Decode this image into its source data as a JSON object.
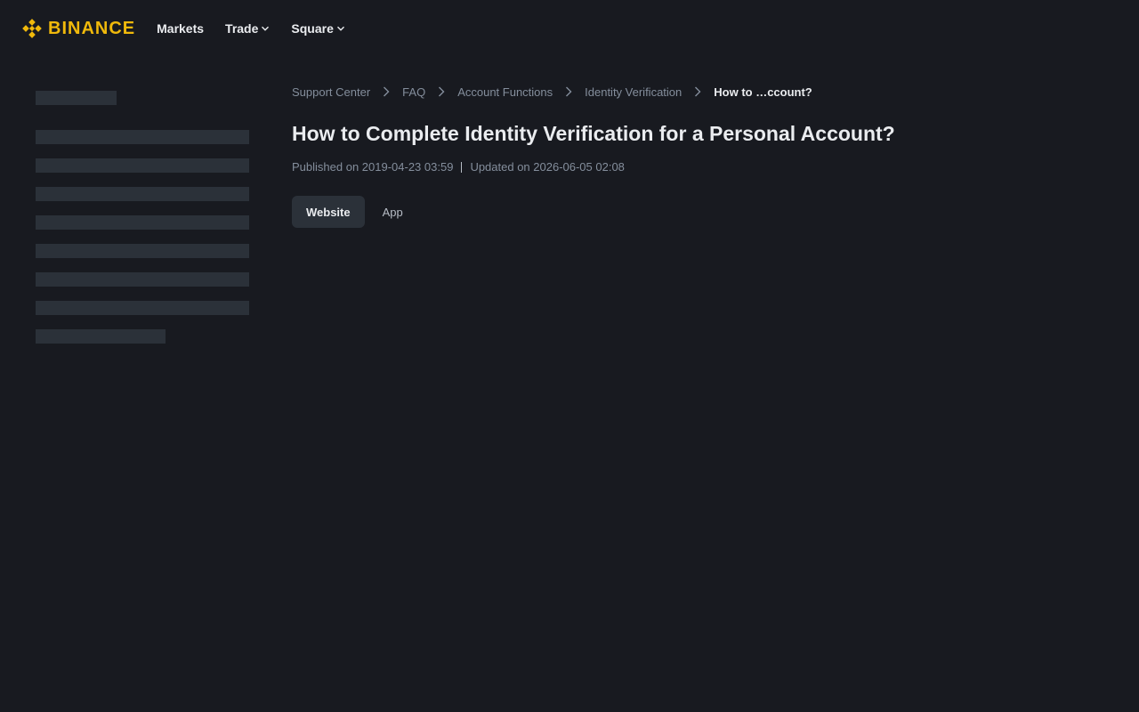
{
  "header": {
    "logo_text": "BINANCE",
    "brand_color": "#f0b90b",
    "nav": [
      {
        "label": "Markets",
        "has_dropdown": false
      },
      {
        "label": "Trade",
        "has_dropdown": true
      },
      {
        "label": "Square",
        "has_dropdown": true
      }
    ]
  },
  "breadcrumb": [
    {
      "label": "Support Center"
    },
    {
      "label": "FAQ"
    },
    {
      "label": "Account Functions"
    },
    {
      "label": "Identity Verification"
    },
    {
      "label": "How to …ccount?"
    }
  ],
  "article": {
    "title": "How to Complete Identity Verification for a Personal Account?",
    "published": "Published on 2019-04-23 03:59",
    "updated": "Updated on 2026-06-05 02:08"
  },
  "tabs": [
    {
      "label": "Website",
      "active": true
    },
    {
      "label": "App",
      "active": false
    }
  ],
  "colors": {
    "background": "#181a20",
    "skeleton": "#2b3139",
    "text_primary": "#eaecef",
    "text_secondary": "#848e9c"
  }
}
